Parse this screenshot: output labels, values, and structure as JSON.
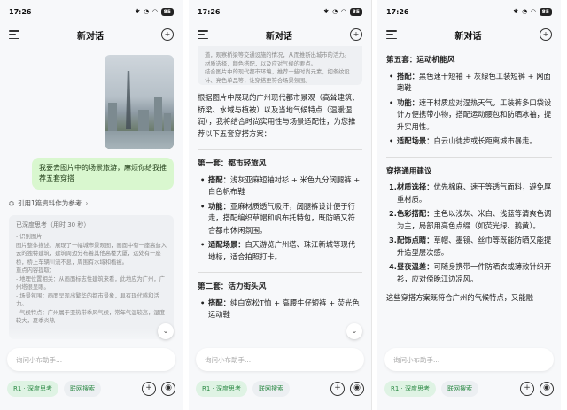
{
  "status": {
    "time": "17:26",
    "battery": "85"
  },
  "header": {
    "title": "新对话"
  },
  "input": {
    "placeholder": "询问小布助手..."
  },
  "chips": {
    "deep_think": "R1 · 深度思考",
    "web_search": "联网搜索"
  },
  "icons": [
    "menu-icon",
    "new-chat-icon",
    "plus-icon",
    "voice-icon",
    "chevron-down-icon",
    "photo"
  ],
  "screen1": {
    "user_message": "我要去图片中的场景旅游，麻烦你给我推荐五套穿搭",
    "reference": "引用1篇资料作为参考",
    "thinking_head": "已深度思考（用时 30 秒）",
    "thinking_text": "- 识别图片\n图片整体描述：展现了一幅城市景观图，画面中有一座高耸入云的独特建筑，建筑周边分布着其他高楼大厦，远处有一座桥，桥上车辆川流不息，周围有水域和植被。\n重点内容提取：\n- 地理位置相关：从画面标志性建筑来看，此地应为广州，广州塔很显眼。\n- 场景氛围：画面呈现出繁华的都市景象，具有现代感和活力。\n- 气候特点：广州属于亚热带季风气候，常年气温较高，湿度较大，夏季炎热"
  },
  "screen2": {
    "thinking_text": "道，观察桥梁等交通设施的情况，从而推断出城市的活力。\n材质选择，颜色搭配，以及应对气候的要点。\n结合图片中的现代都市环境，推荐一些时尚元素，如条纹设计、亮色单品等，让穿搭更符合场景氛围。",
    "intro": "根据图片中展现的广州现代都市景观（高耸建筑、桥梁、水域与植被）以及当地气候特点（温暖湿润），我将结合时尚实用性与场景适配性，为您推荐以下五套穿搭方案：",
    "set1": {
      "title": "第一套：都市轻旅风",
      "items": [
        {
          "label": "搭配：",
          "text": "浅灰亚麻短袖衬衫 + 米色九分阔腿裤 + 白色帆布鞋"
        },
        {
          "label": "功能：",
          "text": "亚麻材质透气吸汗，阔腿裤设计便于行走，搭配编织草帽和帆布托特包，既防晒又符合都市休闲氛围。"
        },
        {
          "label": "适配场景：",
          "text": "白天游览广州塔、珠江新城等现代地标，适合拍照打卡。"
        }
      ]
    },
    "set2": {
      "title": "第二套：活力街头风",
      "items": [
        {
          "label": "搭配：",
          "text": "纯白宽松T恤 + 高腰牛仔短裤 + 荧光色运动鞋"
        }
      ]
    }
  },
  "screen3": {
    "set5": {
      "title": "第五套：运动机能风",
      "items": [
        {
          "label": "搭配：",
          "text": "黑色速干短袖 + 灰绿色工装短裤 + 网面跑鞋"
        },
        {
          "label": "功能：",
          "text": "速干材质应对湿热天气，工装裤多口袋设计方便携带小物，搭配运动腰包和防晒冰袖，提升实用性。"
        },
        {
          "label": "适配场景：",
          "text": "白云山徒步或长距离城市暴走。"
        }
      ]
    },
    "tips_title": "穿搭通用建议",
    "tips": [
      {
        "n": "1.",
        "label": "材质选择：",
        "text": "优先棉麻、速干等透气面料，避免厚重材质。"
      },
      {
        "n": "2.",
        "label": "色彩搭配：",
        "text": "主色以浅灰、米白、浅蓝等清爽色调为主，局部用亮色点缀（如荧光绿、鹅黄）。"
      },
      {
        "n": "3.",
        "label": "配饰点睛：",
        "text": "草帽、墨镜、丝巾等既能防晒又能提升造型层次感。"
      },
      {
        "n": "4.",
        "label": "昼夜温差：",
        "text": "可随身携带一件防晒衣或薄款针织开衫，应对傍晚江边凉风。"
      }
    ],
    "outro": "这些穿搭方案既符合广州的气候特点，又能融"
  }
}
